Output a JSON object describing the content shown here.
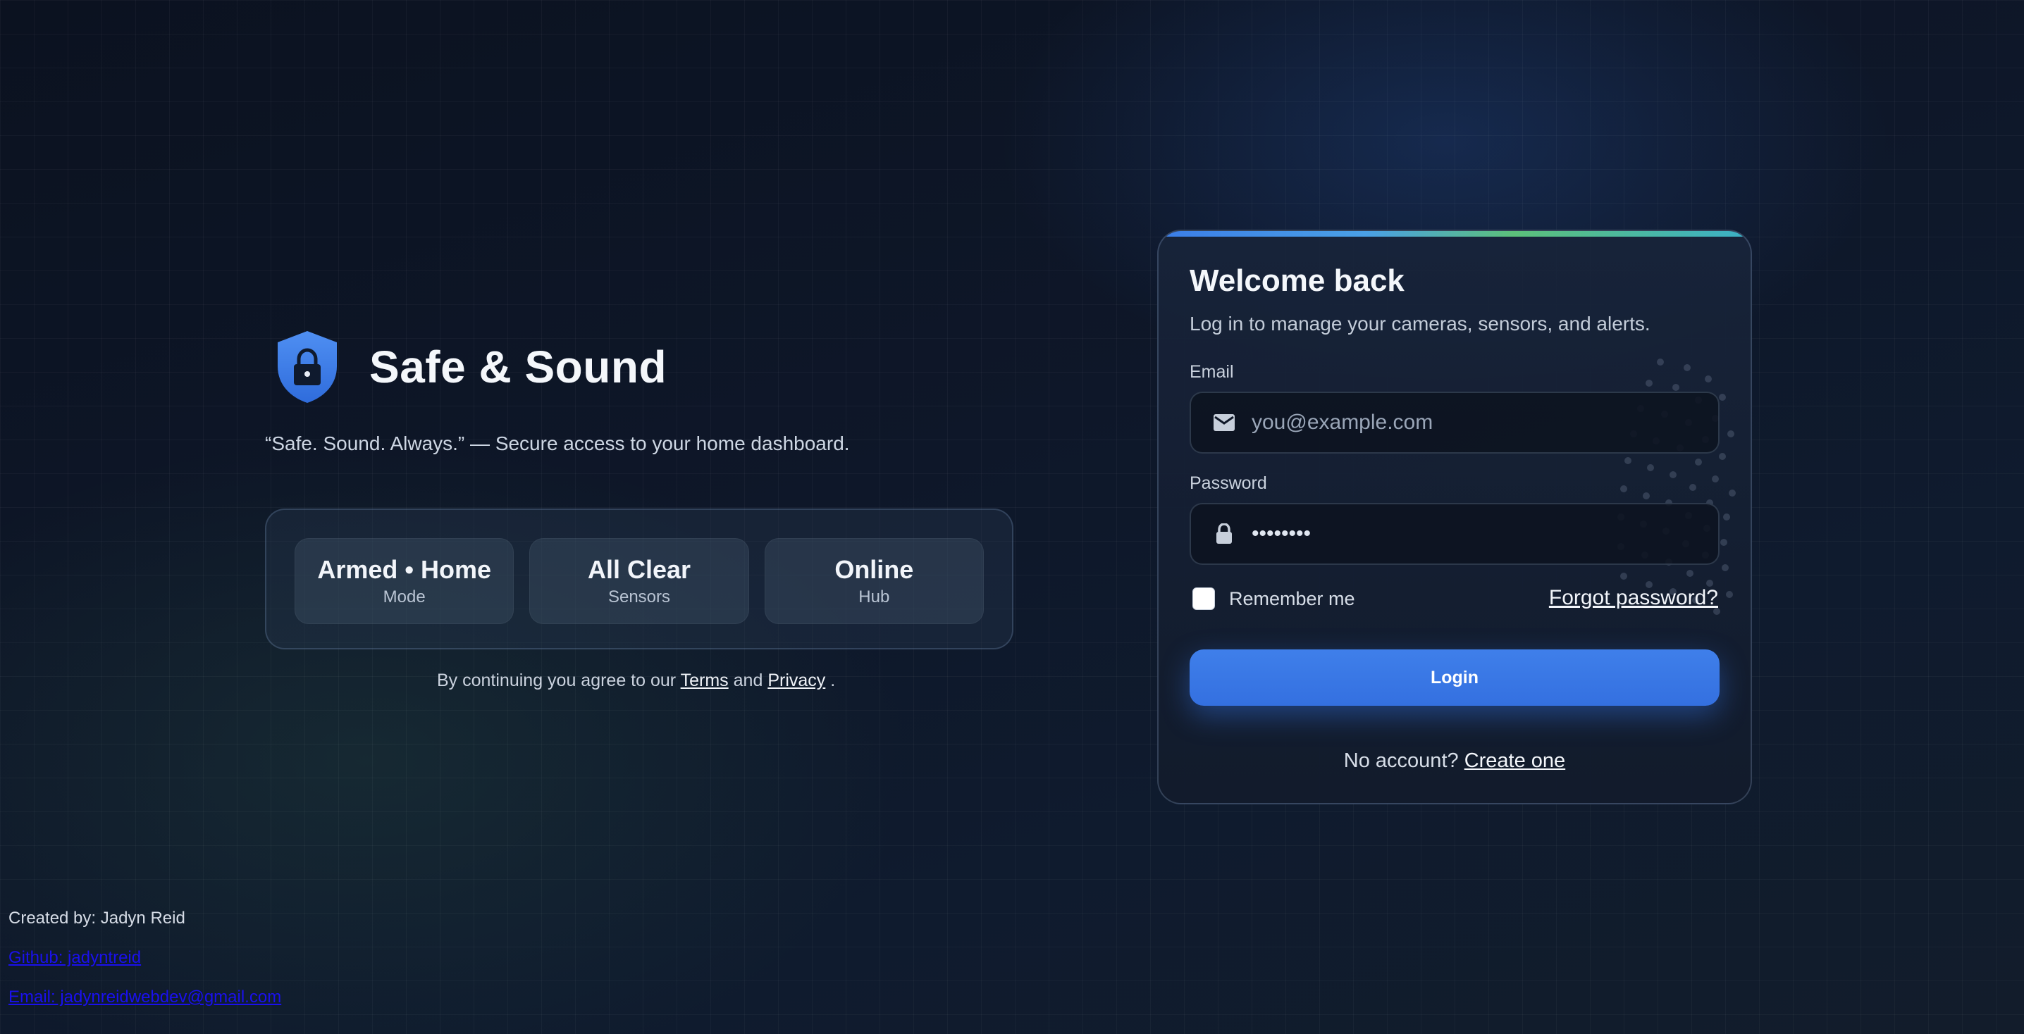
{
  "brand": {
    "title": "Safe & Sound",
    "tagline": "“Safe. Sound. Always.” — Secure access to your home dashboard.",
    "logo_icon": "shield-lock-icon",
    "accent_color": "#3b82f6"
  },
  "status": [
    {
      "value": "Armed • Home",
      "label": "Mode"
    },
    {
      "value": "All Clear",
      "label": "Sensors"
    },
    {
      "value": "Online",
      "label": "Hub"
    }
  ],
  "legal": {
    "prefix": "By continuing you agree to our",
    "terms_link": "Terms",
    "and": "and",
    "privacy_link": "Privacy",
    "suffix": "."
  },
  "credits": {
    "created_by": "Created by: Jadyn Reid",
    "github": "Github: jadyntreid",
    "email": "Email: jadynreidwebdev@gmail.com"
  },
  "login": {
    "title": "Welcome back",
    "subtitle": "Log in to manage your cameras, sensors, and alerts.",
    "email_label": "Email",
    "email_placeholder": "you@example.com",
    "email_icon": "mail-icon",
    "password_label": "Password",
    "password_value": "password",
    "password_icon": "lock-icon",
    "remember_label": "Remember me",
    "remember_checked": false,
    "forgot_link": "Forgot password?",
    "submit_label": "Login",
    "no_account": "No account?",
    "create_link": "Create one",
    "button_color": "#3b78e7"
  }
}
